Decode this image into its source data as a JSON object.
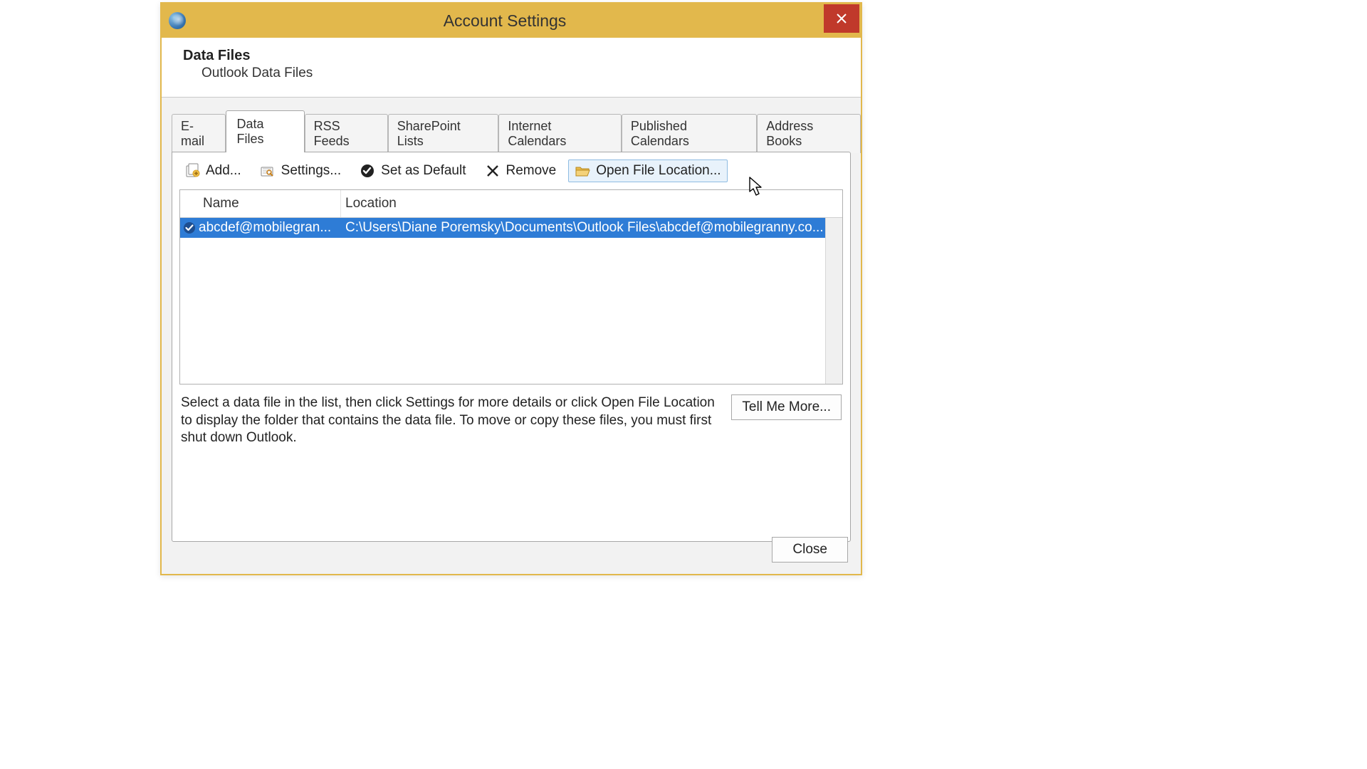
{
  "window": {
    "title": "Account Settings"
  },
  "header": {
    "heading": "Data Files",
    "subtitle": "Outlook Data Files"
  },
  "tabs": [
    {
      "label": "E-mail"
    },
    {
      "label": "Data Files"
    },
    {
      "label": "RSS Feeds"
    },
    {
      "label": "SharePoint Lists"
    },
    {
      "label": "Internet Calendars"
    },
    {
      "label": "Published Calendars"
    },
    {
      "label": "Address Books"
    }
  ],
  "active_tab_index": 1,
  "toolbar": {
    "add": "Add...",
    "settings": "Settings...",
    "set_default": "Set as Default",
    "remove": "Remove",
    "open_location": "Open File Location..."
  },
  "columns": {
    "name": "Name",
    "location": "Location"
  },
  "rows": [
    {
      "name": "abcdef@mobilegran...",
      "location": "C:\\Users\\Diane Poremsky\\Documents\\Outlook Files\\abcdef@mobilegranny.co...",
      "default": true,
      "selected": true
    }
  ],
  "hint_text": "Select a data file in the list, then click Settings for more details or click Open File Location to display the folder that contains the data file. To move or copy these files, you must first shut down Outlook.",
  "buttons": {
    "tell_me_more": "Tell Me More...",
    "close": "Close"
  }
}
